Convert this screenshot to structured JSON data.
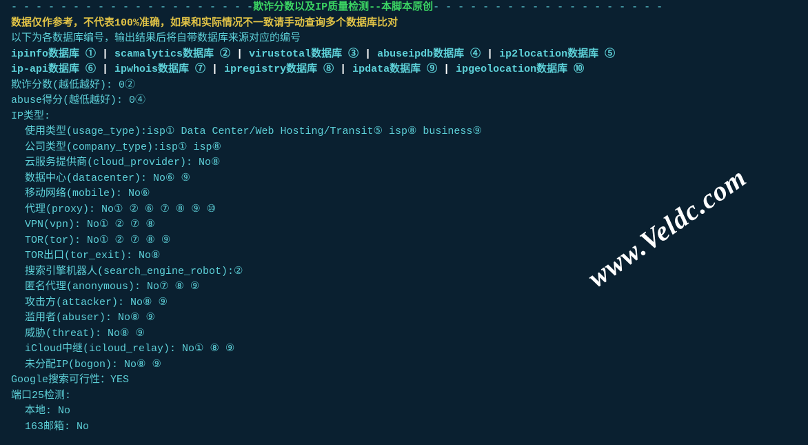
{
  "topline": {
    "prefix_dashes": "-  -  -  -  -  -  -  -  -  -  -  -  -  -  -  -  -  -  -  -",
    "title": "欺诈分数以及IP质量检测--本脚本原创",
    "suffix_dashes": "-  -  -  -  -  -  -  -  -  -  -  -  -  -  -  -  -  -  -"
  },
  "warning": "数据仅作参考，不代表100%准确，如果和实际情况不一致请手动查询多个数据库比对",
  "db_intro": "以下为各数据库编号，输出结果后将自带数据库来源对应的编号",
  "db_row1": {
    "ipinfo": "ipinfo数据库    ①",
    "sep1": "   |  ",
    "scamalytics": "scamalytics数据库  ②",
    "sep2": "   |  ",
    "virustotal": "virustotal数据库  ③",
    "sep3": "   |  ",
    "abuseipdb": "abuseipdb数据库    ④",
    "sep4": "   |  ",
    "ip2location": "ip2location数据库    ⑤"
  },
  "db_row2": {
    "ipapi": "ip-api数据库  ⑥",
    "sep1": "   |  ",
    "ipwhois": "ipwhois数据库         ⑦",
    "sep2": "   |  ",
    "ipregistry": "ipregistry数据库  ⑧",
    "sep3": "   |  ",
    "ipdata": "ipdata数据库        ⑨",
    "sep4": "   |  ",
    "ipgeolocation": "ipgeolocation数据库  ⑩"
  },
  "fraud_score": {
    "label": "欺诈分数(越低越好): ",
    "value": "0②"
  },
  "abuse_score": {
    "label": "abuse得分(越低越好): ",
    "value": "0④"
  },
  "ip_type_header": "IP类型:",
  "lines": {
    "usage_type": "使用类型(usage_type):isp①  Data Center/Web Hosting/Transit⑤  isp⑧  business⑨",
    "company_type": "公司类型(company_type):isp①  isp⑧",
    "cloud_provider": "云服务提供商(cloud_provider):    No⑧",
    "datacenter": "数据中心(datacenter):    No⑥ ⑨",
    "mobile": "移动网络(mobile):    No⑥",
    "proxy": "代理(proxy):    No① ② ⑥ ⑦ ⑧ ⑨ ⑩",
    "vpn": "VPN(vpn):    No① ② ⑦ ⑧",
    "tor": "TOR(tor):    No① ② ⑦ ⑧ ⑨",
    "tor_exit": "TOR出口(tor_exit):    No⑧",
    "search_engine_robot": "搜索引擎机器人(search_engine_robot):②",
    "anonymous": "匿名代理(anonymous):    No⑦ ⑧ ⑨",
    "attacker": "攻击方(attacker):    No⑧ ⑨",
    "abuser": "滥用者(abuser):    No⑧ ⑨",
    "threat": "威胁(threat):    No⑧ ⑨",
    "icloud_relay": "iCloud中继(icloud_relay):    No① ⑧ ⑨",
    "bogon": "未分配IP(bogon):    No⑧ ⑨"
  },
  "google_search": {
    "label": "Google搜索可行性：",
    "value": "YES"
  },
  "port25_header": "端口25检测:",
  "port25": {
    "local_label": "本地: ",
    "local_value": "No",
    "163_label": "163邮箱: ",
    "163_value": "No"
  },
  "watermark": "www.Veldc.com"
}
